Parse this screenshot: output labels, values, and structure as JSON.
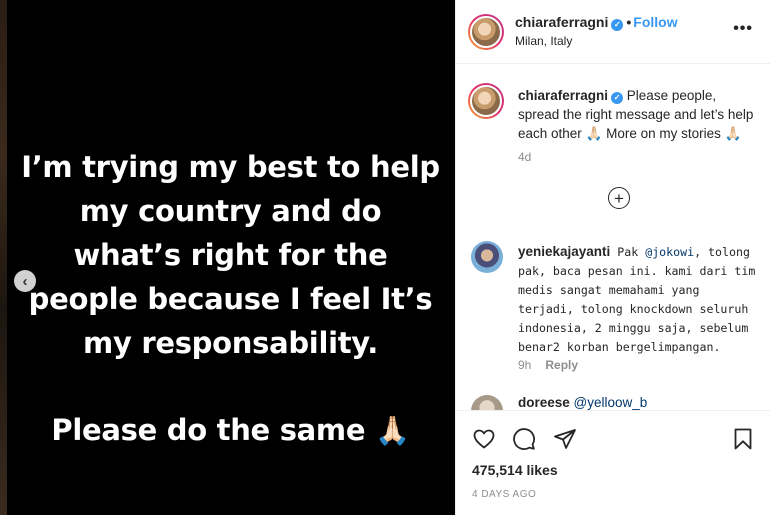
{
  "post": {
    "image_lines": [
      "I’m trying my best to help",
      "my country and do",
      "what’s right for the",
      "people because I feel It’s",
      "my responsability.",
      "Please do the same"
    ],
    "image_emoji": "🙏🏻"
  },
  "header": {
    "username": "chiaraferragni",
    "verified_icon": "verified-badge-icon",
    "separator": "•",
    "follow_label": "Follow",
    "location": "Milan, Italy",
    "more_icon": "•••"
  },
  "caption": {
    "username": "chiaraferragni",
    "text_a": " Please people, spread the right message and let’s help each other ",
    "emoji_a": "🙏🏻",
    "text_b": " More on my stories ",
    "emoji_b": "🙏🏻",
    "time": "4d"
  },
  "load_more_icon": "plus-circle-icon",
  "comments": [
    {
      "username": "yeniekajayanti",
      "text_pre": " Pak ",
      "mention": "@jokowi",
      "text_post": ", tolong pak, baca pesan ini. kami dari tim medis sangat memahami yang terjadi, tolong knockdown seluruh indonesia, 2 minggu saja, sebelum benar2 korban bergelimpangan.",
      "time": "9h",
      "reply_label": "Reply"
    },
    {
      "username": "doreese",
      "mention": "@yelloow_b"
    }
  ],
  "actions": {
    "likes": "475,514 likes",
    "date": "4 DAYS AGO"
  },
  "nav": {
    "prev_label": "‹"
  },
  "colors": {
    "accent": "#3897f0",
    "text": "#262626",
    "muted": "#8e8e8e",
    "border": "#efefef"
  }
}
